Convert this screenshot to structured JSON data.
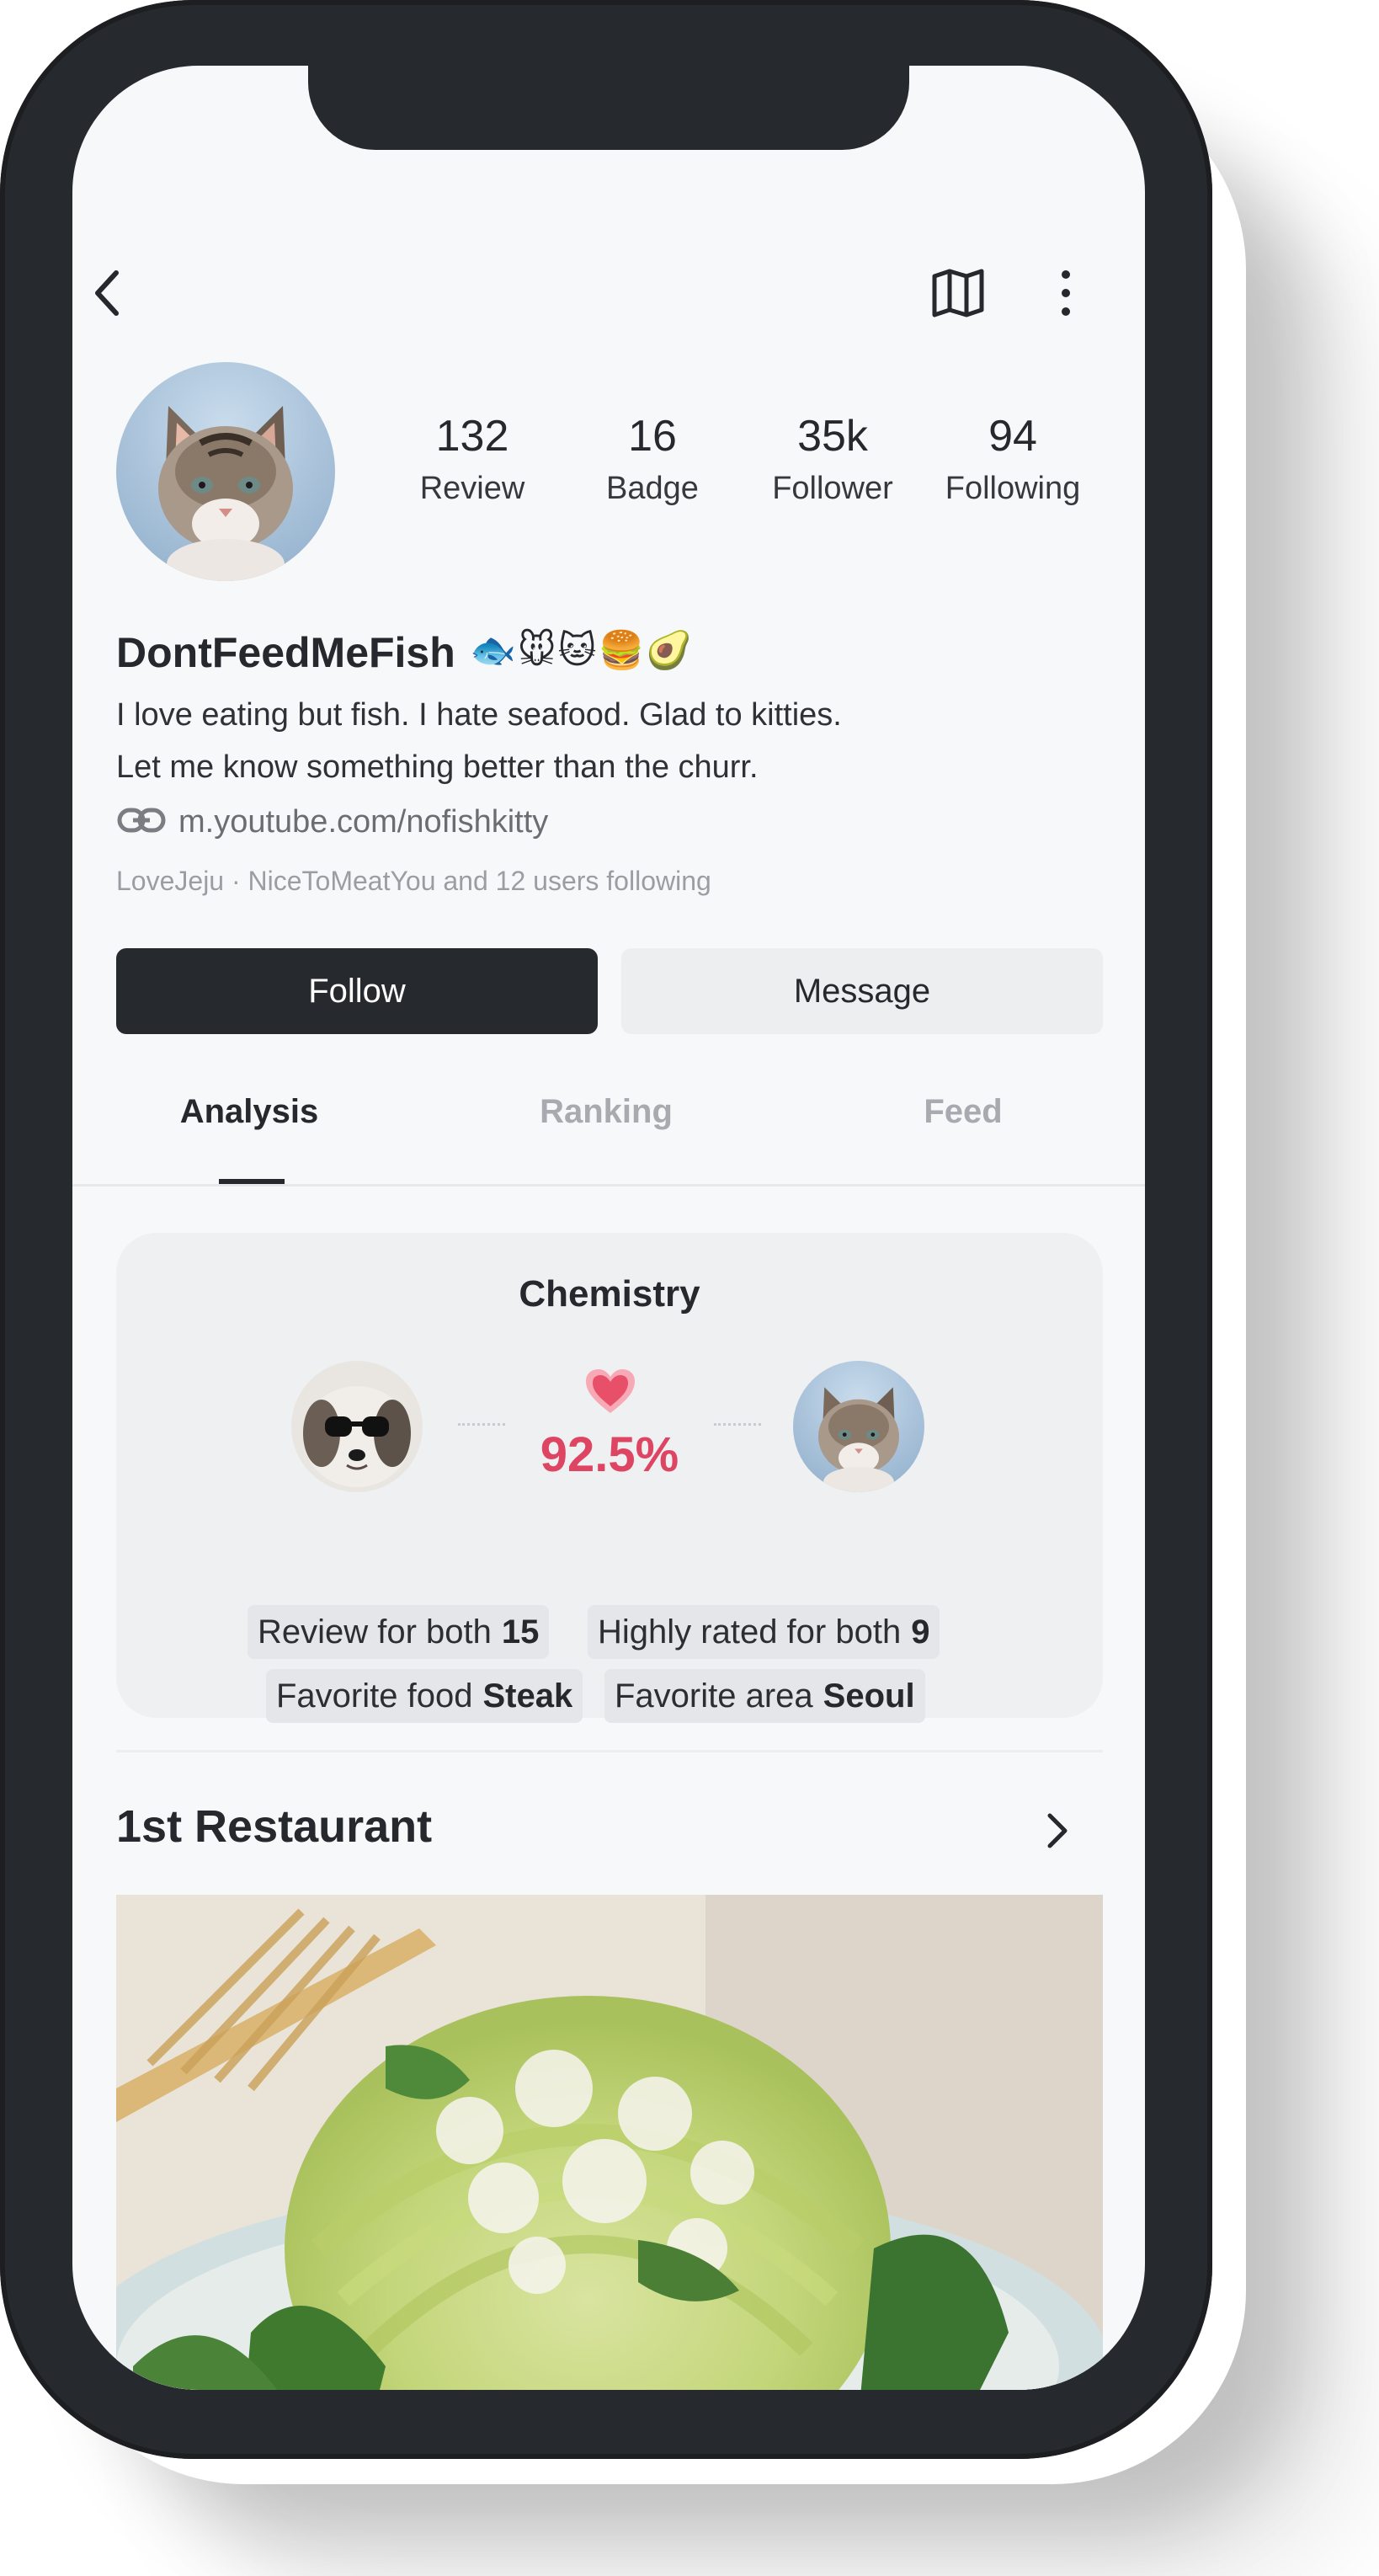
{
  "nav": {
    "back_icon": "chevron-left-icon",
    "map_icon": "map-icon",
    "more_icon": "more-vertical-icon"
  },
  "profile": {
    "stats": [
      {
        "value": "132",
        "label": "Review"
      },
      {
        "value": "16",
        "label": "Badge"
      },
      {
        "value": "35k",
        "label": "Follower"
      },
      {
        "value": "94",
        "label": "Following"
      }
    ],
    "username": "DontFeedMeFish",
    "emojis": "🐟🐭🐱🍔🥑",
    "bio_line1": "I love eating but fish. I hate seafood. Glad to kitties.",
    "bio_line2": "Let me know something better than the churr.",
    "link": "m.youtube.com/nofishkitty",
    "following_note": "LoveJeju · NiceToMeatYou and 12 users following"
  },
  "actions": {
    "follow": "Follow",
    "message": "Message"
  },
  "tabs": [
    {
      "label": "Analysis",
      "active": true
    },
    {
      "label": "Ranking",
      "active": false
    },
    {
      "label": "Feed",
      "active": false
    }
  ],
  "chemistry": {
    "title": "Chemistry",
    "score": "92.5%",
    "chips": [
      {
        "label": "Review for both",
        "value": "15"
      },
      {
        "label": "Highly rated for both",
        "value": "9"
      },
      {
        "label": "Favorite food",
        "value": "Steak"
      },
      {
        "label": "Favorite area",
        "value": "Seoul"
      }
    ]
  },
  "restaurant": {
    "title": "1st Restaurant"
  },
  "colors": {
    "accent_score": "#dd4562",
    "primary_button": "#26292d",
    "secondary_button": "#eceef0"
  }
}
